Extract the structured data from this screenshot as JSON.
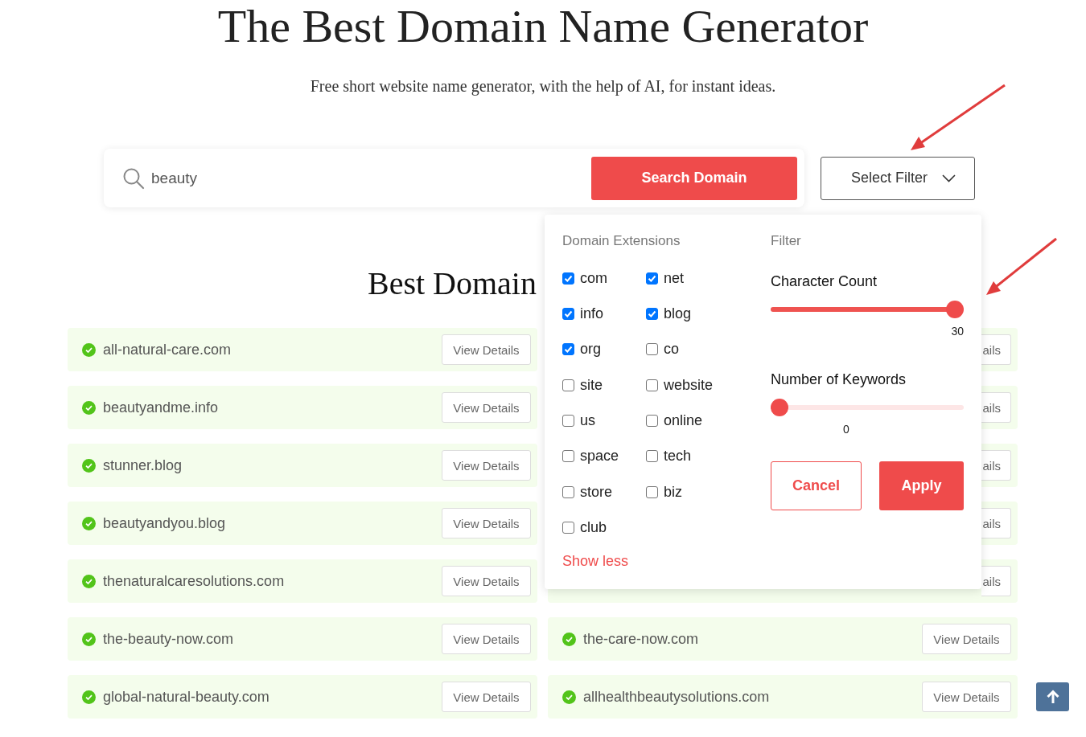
{
  "page": {
    "title": "The Best Domain Name Generator",
    "subtitle": "Free short website name generator, with the help of AI, for instant ideas."
  },
  "search": {
    "value": "beauty",
    "button": "Search Domain"
  },
  "filter_button": {
    "label": "Select Filter"
  },
  "section_heading": "Best Domain",
  "results": {
    "left": [
      {
        "domain": "all-natural-care.com",
        "button": "View Details"
      },
      {
        "domain": "beautyandme.info",
        "button": "View Details"
      },
      {
        "domain": "stunner.blog",
        "button": "View Details"
      },
      {
        "domain": "beautyandyou.blog",
        "button": "View Details"
      },
      {
        "domain": "thenaturalcaresolutions.com",
        "button": "View Details"
      },
      {
        "domain": "the-beauty-now.com",
        "button": "View Details"
      },
      {
        "domain": "global-natural-beauty.com",
        "button": "View Details"
      }
    ],
    "right": [
      {
        "button": "ails"
      },
      {
        "button": "ails"
      },
      {
        "button": "ails"
      },
      {
        "button": "ails"
      },
      {
        "button": "ails"
      },
      {
        "domain": "the-care-now.com",
        "button": "View Details"
      },
      {
        "domain": "allhealthbeautysolutions.com",
        "button": "View Details"
      }
    ]
  },
  "filter_panel": {
    "extensions_heading": "Domain Extensions",
    "extensions": [
      {
        "label": "com",
        "checked": true
      },
      {
        "label": "net",
        "checked": true
      },
      {
        "label": "info",
        "checked": true
      },
      {
        "label": "blog",
        "checked": true
      },
      {
        "label": "org",
        "checked": true
      },
      {
        "label": "co",
        "checked": false
      },
      {
        "label": "site",
        "checked": false
      },
      {
        "label": "website",
        "checked": false
      },
      {
        "label": "us",
        "checked": false
      },
      {
        "label": "online",
        "checked": false
      },
      {
        "label": "space",
        "checked": false
      },
      {
        "label": "tech",
        "checked": false
      },
      {
        "label": "store",
        "checked": false
      },
      {
        "label": "biz",
        "checked": false
      },
      {
        "label": "club",
        "checked": false
      }
    ],
    "show_less": "Show less",
    "filter_heading": "Filter",
    "sliders": [
      {
        "label": "Character Count",
        "level": 1,
        "reading": "30"
      },
      {
        "label": "Number of Keywords",
        "level": 0,
        "reading": "0"
      }
    ],
    "cancel": "Cancel",
    "apply": "Apply"
  }
}
